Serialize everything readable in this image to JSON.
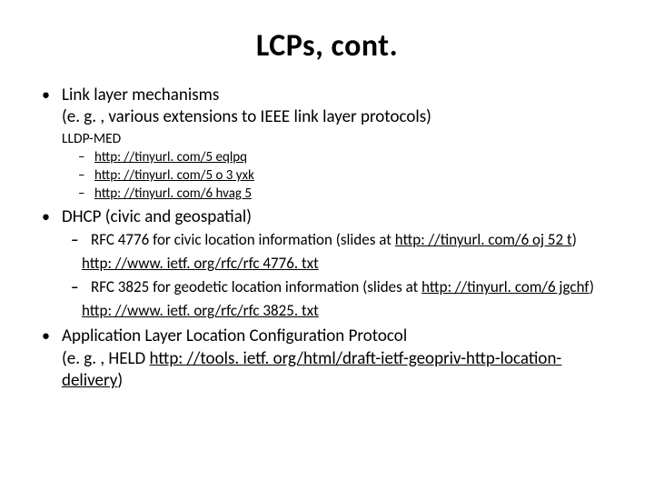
{
  "title": "LCPs, cont.",
  "bullets": [
    {
      "line1": "Link layer mechanisms",
      "line2": "(e. g. , various extensions to IEEE link layer protocols)",
      "subhead": "LLDP-MED",
      "links": [
        "http: //tinyurl. com/5 eqlpq",
        "http: //tinyurl. com/5 o 3 yxk",
        "http: //tinyurl. com/6 hvag 5"
      ]
    },
    {
      "head": "DHCP (civic and geospatial)",
      "subs": [
        {
          "pre": "RFC 4776 for civic location information (slides at ",
          "link": "http: //tinyurl. com/6 oj 52 t",
          "post": ")",
          "url": "http: //www. ietf. org/rfc/rfc 4776. txt"
        },
        {
          "pre": "RFC 3825 for geodetic location information (slides at ",
          "link": "http: //tinyurl. com/6 jgchf",
          "post": ")",
          "url": "http: //www. ietf. org/rfc/rfc 3825. txt"
        }
      ]
    },
    {
      "line1": "Application Layer Location Configuration Protocol",
      "pre": "(e. g. , HELD ",
      "link": "http: //tools. ietf. org/html/draft-ietf-geopriv-http-location-delivery",
      "post": ")"
    }
  ]
}
